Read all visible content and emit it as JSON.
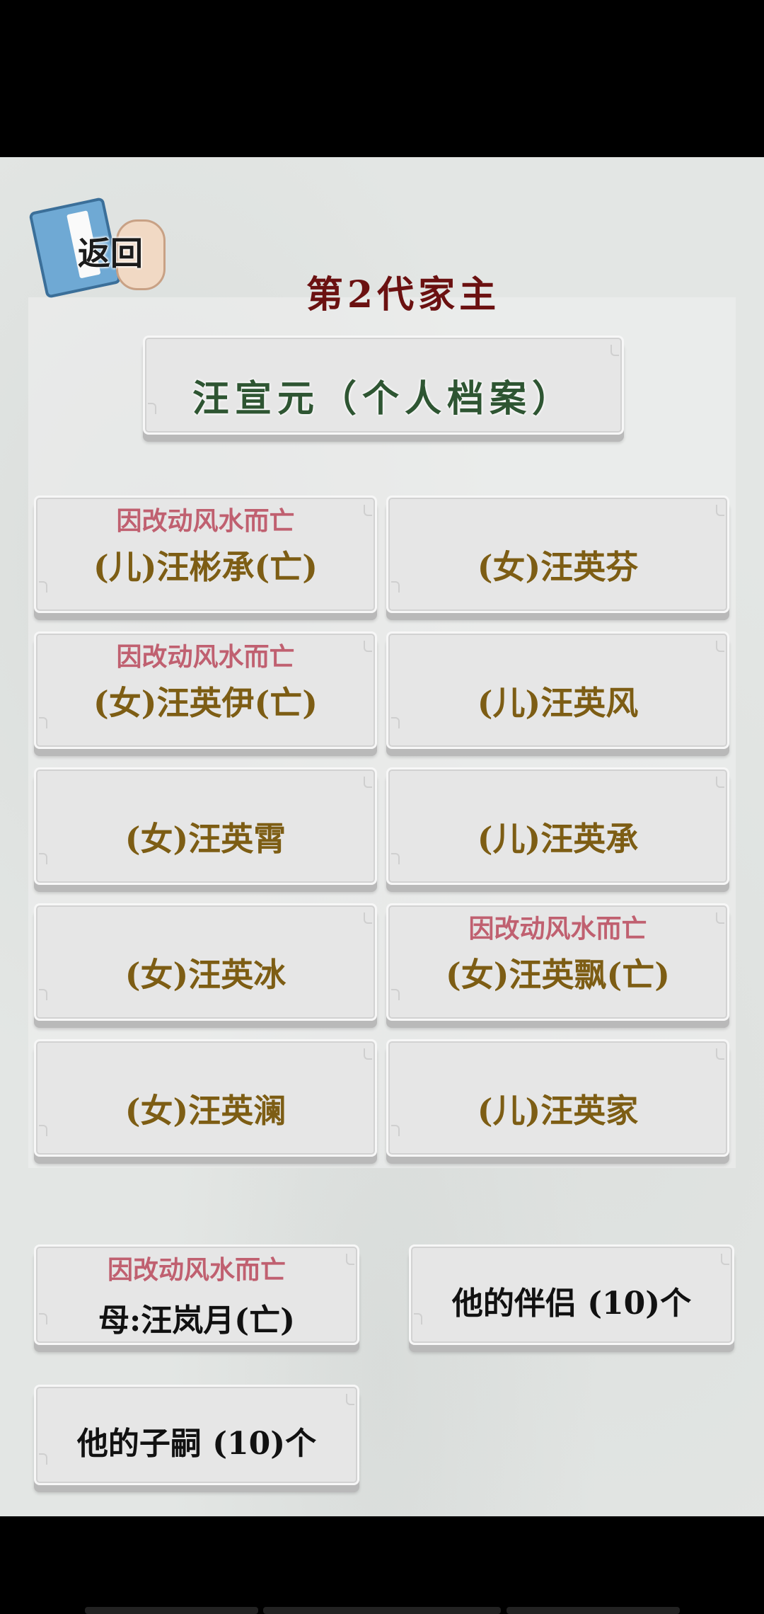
{
  "back_label": "返回",
  "generation_title": "第2代家主",
  "profile_title": "汪宣元（个人档案）",
  "children": [
    {
      "cause": "因改动风水而亡",
      "name": "(儿)汪彬承(亡)"
    },
    {
      "cause": "",
      "name": "(女)汪英芬"
    },
    {
      "cause": "因改动风水而亡",
      "name": "(女)汪英伊(亡)"
    },
    {
      "cause": "",
      "name": "(儿)汪英风"
    },
    {
      "cause": "",
      "name": "(女)汪英霄"
    },
    {
      "cause": "",
      "name": "(儿)汪英承"
    },
    {
      "cause": "",
      "name": "(女)汪英冰"
    },
    {
      "cause": "因改动风水而亡",
      "name": "(女)汪英飘(亡)"
    },
    {
      "cause": "",
      "name": "(女)汪英澜"
    },
    {
      "cause": "",
      "name": "(儿)汪英家"
    }
  ],
  "mother": {
    "cause": "因改动风水而亡",
    "label": "母:汪岚月(亡)"
  },
  "partners_label": "他的伴侣 (10)个",
  "heirs_label": "他的子嗣 (10)个"
}
